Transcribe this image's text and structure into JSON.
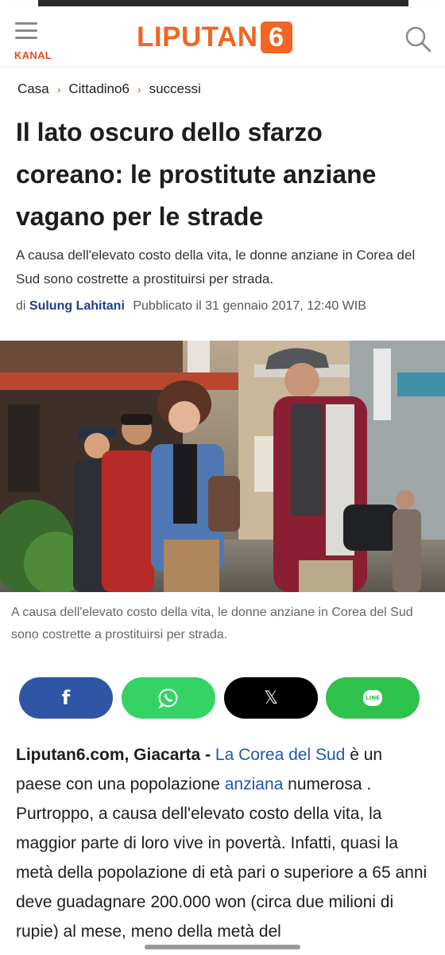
{
  "header": {
    "menu_label": "KANAL",
    "logo_text": "LIPUTAN",
    "logo_number": "6"
  },
  "breadcrumb": {
    "items": [
      "Casa",
      "Cittadino6",
      "successi"
    ],
    "separator": "›"
  },
  "article": {
    "title": "Il lato oscuro dello sfarzo coreano: le prostitute anziane vagano per le strade",
    "subtitle": "A causa dell'elevato costo della vita, le donne anziane in Corea del Sud sono costrette a prostituirsi per strada.",
    "byline_prefix": "di",
    "author": "Sulung Lahitani",
    "published": "Pubblicato il 31 gennaio 2017, 12:40 WIB",
    "photo_caption": "A causa dell'elevato costo della vita, le donne anziane in Corea del Sud sono costrette a prostituirsi per strada."
  },
  "share": {
    "icons": [
      "facebook-icon",
      "whatsapp-icon",
      "x-icon",
      "line-icon"
    ],
    "facebook_glyph": "f",
    "x_glyph": "𝕏",
    "line_glyph": "LINE"
  },
  "body": {
    "lead": "Liputan6.com, Giacarta -",
    "link_1": "La Corea del Sud",
    "text_1": "è un paese con una popolazione",
    "link_2": "anziana",
    "text_2": "numerosa . Purtroppo, a causa dell'elevato costo della vita, la maggior parte di loro vive in povertà. Infatti, quasi la metà della popolazione di età pari o superiore a 65 anni deve guadagnare 200.000 won (circa due milioni di rupie) al mese, meno della metà del"
  },
  "colors": {
    "brand_orange": "#f26522",
    "link_blue": "#1f58b0",
    "facebook": "#2f56a4",
    "whatsapp": "#35d366",
    "x": "#000000",
    "line": "#2ec24d"
  }
}
